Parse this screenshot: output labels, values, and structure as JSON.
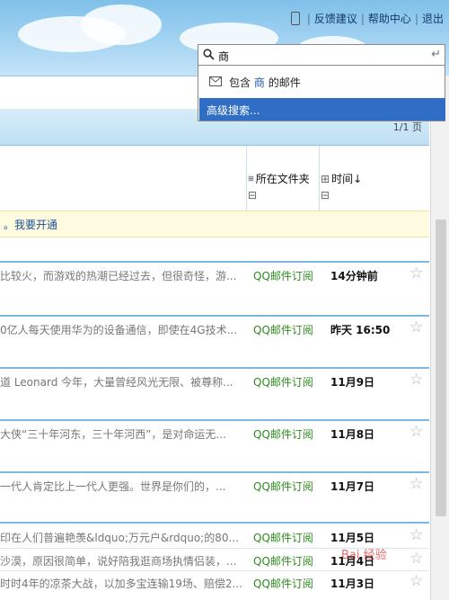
{
  "header": {
    "nav": [
      "反馈建议",
      "帮助中心",
      "退出"
    ],
    "separator": "|"
  },
  "search": {
    "value": "商",
    "suggestion_prefix": "包含",
    "suggestion_keyword": "商",
    "suggestion_suffix": "的邮件",
    "advanced_label": "高级搜索..."
  },
  "pager": {
    "text": "1/1 页"
  },
  "columns": {
    "folder": "所在文件夹",
    "time": "时间↓",
    "expand_glyph": "⊞",
    "collapse_glyph": "⊟"
  },
  "notice": {
    "text": "。我要开通"
  },
  "rows": [
    {
      "subject": "比较火，而游戏的热潮已经过去，但很奇怪，游...",
      "folder": "QQ邮件订阅",
      "time": "14分钟前"
    },
    {
      "subject": "0亿人每天使用华为的设备通信，即使在4G技术...",
      "folder": "QQ邮件订阅",
      "time": "昨天 16:50"
    },
    {
      "subject": "道 Leonard 今年，大量曾经风光无限、被尊称...",
      "folder": "QQ邮件订阅",
      "time": "11月9日"
    },
    {
      "subject": "大侠“三十年河东，三十年河西”，是对命运无...",
      "folder": "QQ邮件订阅",
      "time": "11月8日"
    },
    {
      "subject": "一代人肯定比上一代人更强。世界是你们的，...",
      "folder": "QQ邮件订阅",
      "time": "11月7日"
    },
    {
      "subject": "印在人们普遍艳羡&ldquo;万元户&rdquo;的80...",
      "folder": "QQ邮件订阅",
      "time": "11月5日"
    },
    {
      "subject": "沙漠，原因很简单，说好陪我逛商场执情侣装，...",
      "folder": "QQ邮件订阅",
      "time": "11月4日"
    },
    {
      "subject": "时时4年的凉茶大战，以加多宝连输19场、赔偿2...",
      "folder": "QQ邮件订阅",
      "time": "11月3日"
    }
  ],
  "star_glyph": "☆",
  "watermark": {
    "text": "Bai 经验"
  },
  "colors": {
    "accent": "#2f6ec4",
    "folder_green": "#2f8a1f"
  }
}
